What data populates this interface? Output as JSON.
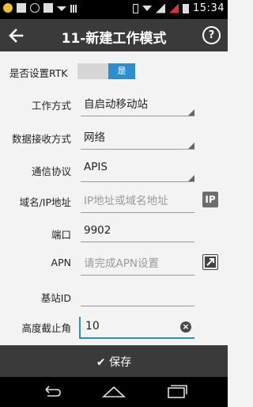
{
  "status_bar": {
    "time": "15:34"
  },
  "title_bar": {
    "title": "11-新建工作模式",
    "help_label": "?"
  },
  "form": {
    "rtk": {
      "label": "是否设置RTK",
      "toggle_text": "是"
    },
    "work_mode": {
      "label": "工作方式",
      "value": "自启动移动站"
    },
    "data_receive": {
      "label": "数据接收方式",
      "value": "网络"
    },
    "protocol": {
      "label": "通信协议",
      "value": "APIS"
    },
    "domain": {
      "label": "域名/IP地址",
      "placeholder": "IP地址或域名地址",
      "icon_text": "IP"
    },
    "port": {
      "label": "端口",
      "value": "9902"
    },
    "apn": {
      "label": "APN",
      "placeholder": "请完成APN设置"
    },
    "station_id": {
      "label": "基站ID",
      "value": ""
    },
    "cutoff": {
      "label": "高度截止角",
      "value": "10",
      "clear": "×"
    }
  },
  "save_bar": {
    "label": "保存",
    "check": "✔"
  },
  "colors": {
    "accent": "#2b8fcf",
    "bar": "#3a3a3a"
  }
}
